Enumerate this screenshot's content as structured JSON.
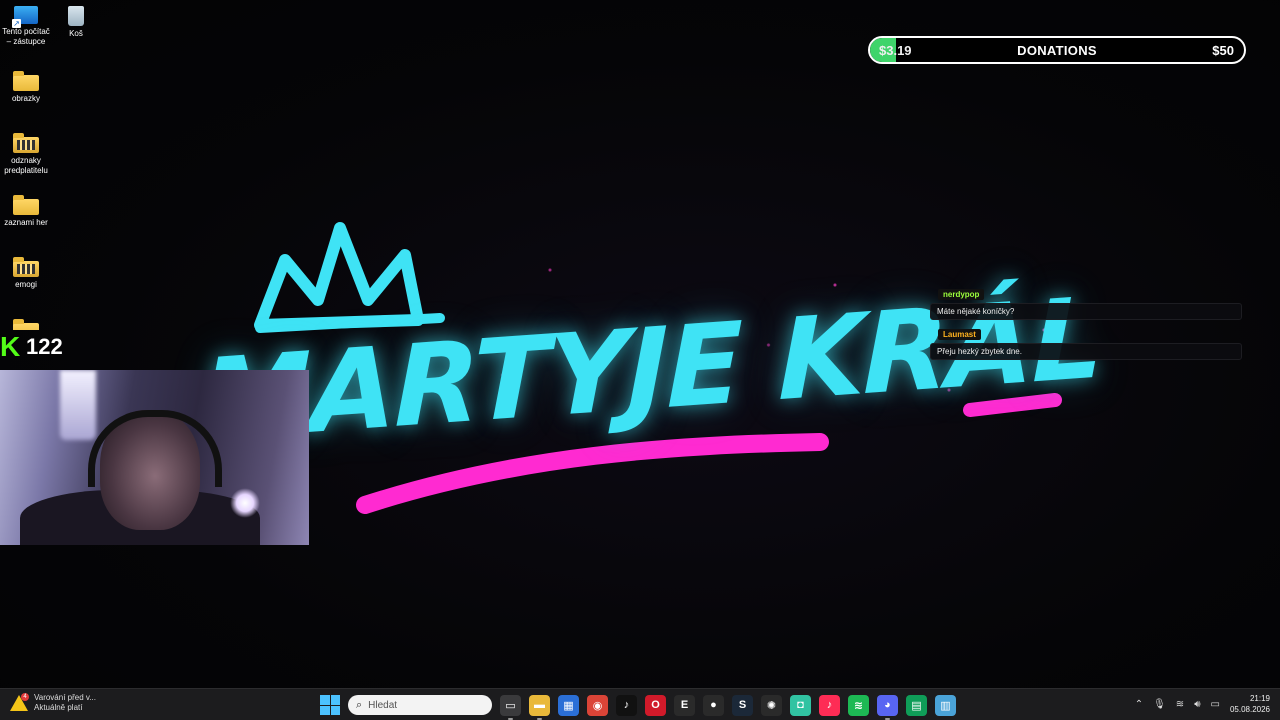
{
  "desktop_icons": [
    {
      "label": "Tento počítač\n– zástupce",
      "icon": "computer-shortcut-icon"
    },
    {
      "label": "Koš",
      "icon": "recycle-bin-icon"
    },
    {
      "label": "obrazky",
      "icon": "folder-icon"
    },
    {
      "label": "odznaky\npredplatitelu",
      "icon": "folder-images-icon"
    },
    {
      "label": "zaznami her",
      "icon": "folder-icon"
    },
    {
      "label": "emogi",
      "icon": "folder-images-icon"
    }
  ],
  "follower_counter": {
    "value": "122",
    "icon": "kick-logo-icon",
    "color": "#53fc18"
  },
  "logo": {
    "text": "MARTYJE KRÁL",
    "color": "#3fe3f5",
    "accent": "#ff2ad1"
  },
  "donations": {
    "current": "$3.19",
    "title": "DONATIONS",
    "goal": "$50",
    "progress_fraction": 0.064,
    "fill_color": "#3fd46a"
  },
  "chat": [
    {
      "user": "nerdypop",
      "user_color": "#9cff3c",
      "text": "Máte nějaké koníčky?"
    },
    {
      "user": "Laumast",
      "user_color": "#ffb21e",
      "text": "Přeju hezký zbytek dne."
    }
  ],
  "taskbar": {
    "notification": {
      "title": "Varování před v...",
      "subtitle": "Aktuálně platí",
      "badge": "4"
    },
    "search_placeholder": "Hledat",
    "apps": [
      {
        "name": "task-view",
        "glyph": "▭",
        "bg": "#3a3a3c"
      },
      {
        "name": "file-explorer",
        "glyph": "▬",
        "bg": "#e9b93a"
      },
      {
        "name": "microsoft-store",
        "glyph": "▦",
        "bg": "#2b6fd6"
      },
      {
        "name": "chrome",
        "glyph": "◉",
        "bg": "#db4437"
      },
      {
        "name": "tiktok",
        "glyph": "♪",
        "bg": "#111111"
      },
      {
        "name": "opera",
        "glyph": "O",
        "bg": "#d11a2a"
      },
      {
        "name": "epic-games",
        "glyph": "E",
        "bg": "#2a2a2a"
      },
      {
        "name": "obs",
        "glyph": "●",
        "bg": "#2a2a2a"
      },
      {
        "name": "steam",
        "glyph": "S",
        "bg": "#1b2838"
      },
      {
        "name": "chatgpt",
        "glyph": "✺",
        "bg": "#2a2a2a"
      },
      {
        "name": "streamlabs",
        "glyph": "◘",
        "bg": "#31c3a2"
      },
      {
        "name": "tiktok-live",
        "glyph": "♪",
        "bg": "#fe2c55"
      },
      {
        "name": "spotify",
        "glyph": "≋",
        "bg": "#1db954"
      },
      {
        "name": "discord",
        "glyph": "◕",
        "bg": "#5865f2"
      },
      {
        "name": "sheets",
        "glyph": "▤",
        "bg": "#0f9d58"
      },
      {
        "name": "notepad",
        "glyph": "▥",
        "bg": "#4aa3d8"
      }
    ],
    "time": "21:19",
    "date": "05.08.2026"
  }
}
